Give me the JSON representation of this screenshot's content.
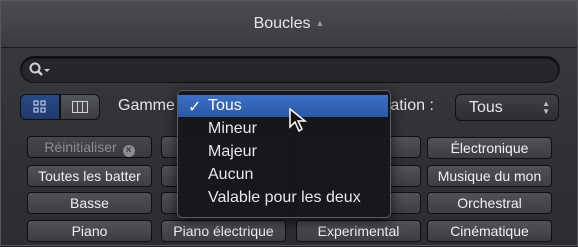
{
  "window": {
    "title": "Boucles"
  },
  "search": {
    "placeholder": ""
  },
  "filters": {
    "gamme_label": "Gamme",
    "duration_label": "ration :",
    "duration_value": "Tous"
  },
  "gamme_menu": {
    "items": [
      "Tous",
      "Mineur",
      "Majeur",
      "Aucun",
      "Valable pour les deux"
    ],
    "selected": "Tous"
  },
  "keywords": {
    "reset": "Réinitialiser",
    "row1": [
      "Électronique"
    ],
    "row2": [
      "Toutes les batter",
      "Musique du mon"
    ],
    "row3": [
      "Basse",
      "Orchestral"
    ],
    "row4": [
      "Piano",
      "Piano électrique",
      "Experimental",
      "Cinématique"
    ]
  },
  "colors": {
    "accent": "#2b58a6",
    "background": "#2f3136"
  }
}
